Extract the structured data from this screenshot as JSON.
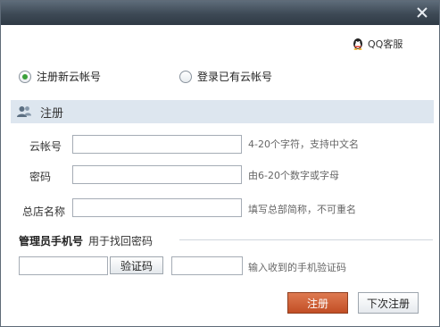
{
  "window": {
    "title": "",
    "close_icon": "close-icon"
  },
  "support": {
    "label": "QQ客服",
    "icon": "qq-penguin-icon"
  },
  "mode": {
    "options": [
      {
        "label": "注册新云帐号",
        "selected": true
      },
      {
        "label": "登录已有云帐号",
        "selected": false
      }
    ]
  },
  "section": {
    "title": "注册",
    "icon": "user-group-icon"
  },
  "form": {
    "account": {
      "label": "云帐号",
      "value": "",
      "hint": "4-20个字符，支持中文名"
    },
    "password": {
      "label": "密码",
      "value": "",
      "hint": "由6-20个数字或字母"
    },
    "store_name": {
      "label": "总店名称",
      "value": "",
      "hint": "填写总部简称，不可重名"
    }
  },
  "manager": {
    "title": "管理员手机号",
    "subtitle": "用于找回密码",
    "phone_value": "",
    "verify_button": "验证码",
    "code_value": "",
    "code_hint": "输入收到的手机验证码"
  },
  "actions": {
    "register": "注册",
    "later": "下次注册"
  },
  "colors": {
    "accent": "#c85a30",
    "header_band": "#dde6ef",
    "radio_selected": "#3aa03a"
  }
}
